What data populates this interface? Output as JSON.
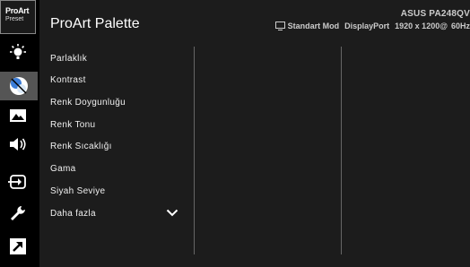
{
  "sidebar": {
    "logo_line1": "ProArt",
    "logo_line2": "Preset",
    "items": [
      {
        "icon": "brightness-icon",
        "active": false
      },
      {
        "icon": "color-icon",
        "active": true
      },
      {
        "icon": "image-icon",
        "active": false
      },
      {
        "icon": "sound-icon",
        "active": false
      },
      {
        "icon": "input-icon",
        "active": false
      },
      {
        "icon": "system-icon",
        "active": false
      },
      {
        "icon": "shortcut-icon",
        "active": false
      }
    ]
  },
  "header": {
    "title": "ProArt Palette",
    "model": "ASUS PA248QV",
    "mode": "Standart Mod",
    "input": "DisplayPort",
    "resolution": "1920 x 1200@",
    "refresh": "60Hz"
  },
  "menu": {
    "items": [
      "Parlaklık",
      "Kontrast",
      "Renk Doygunluğu",
      "Renk Tonu",
      "Renk Sıcaklığı",
      "Gama",
      "Siyah Seviye",
      "Daha fazla"
    ]
  },
  "colors": {
    "accent": "#4aa8ff",
    "panel_bg": "#1c1c1c",
    "active_tab": "#555555"
  }
}
